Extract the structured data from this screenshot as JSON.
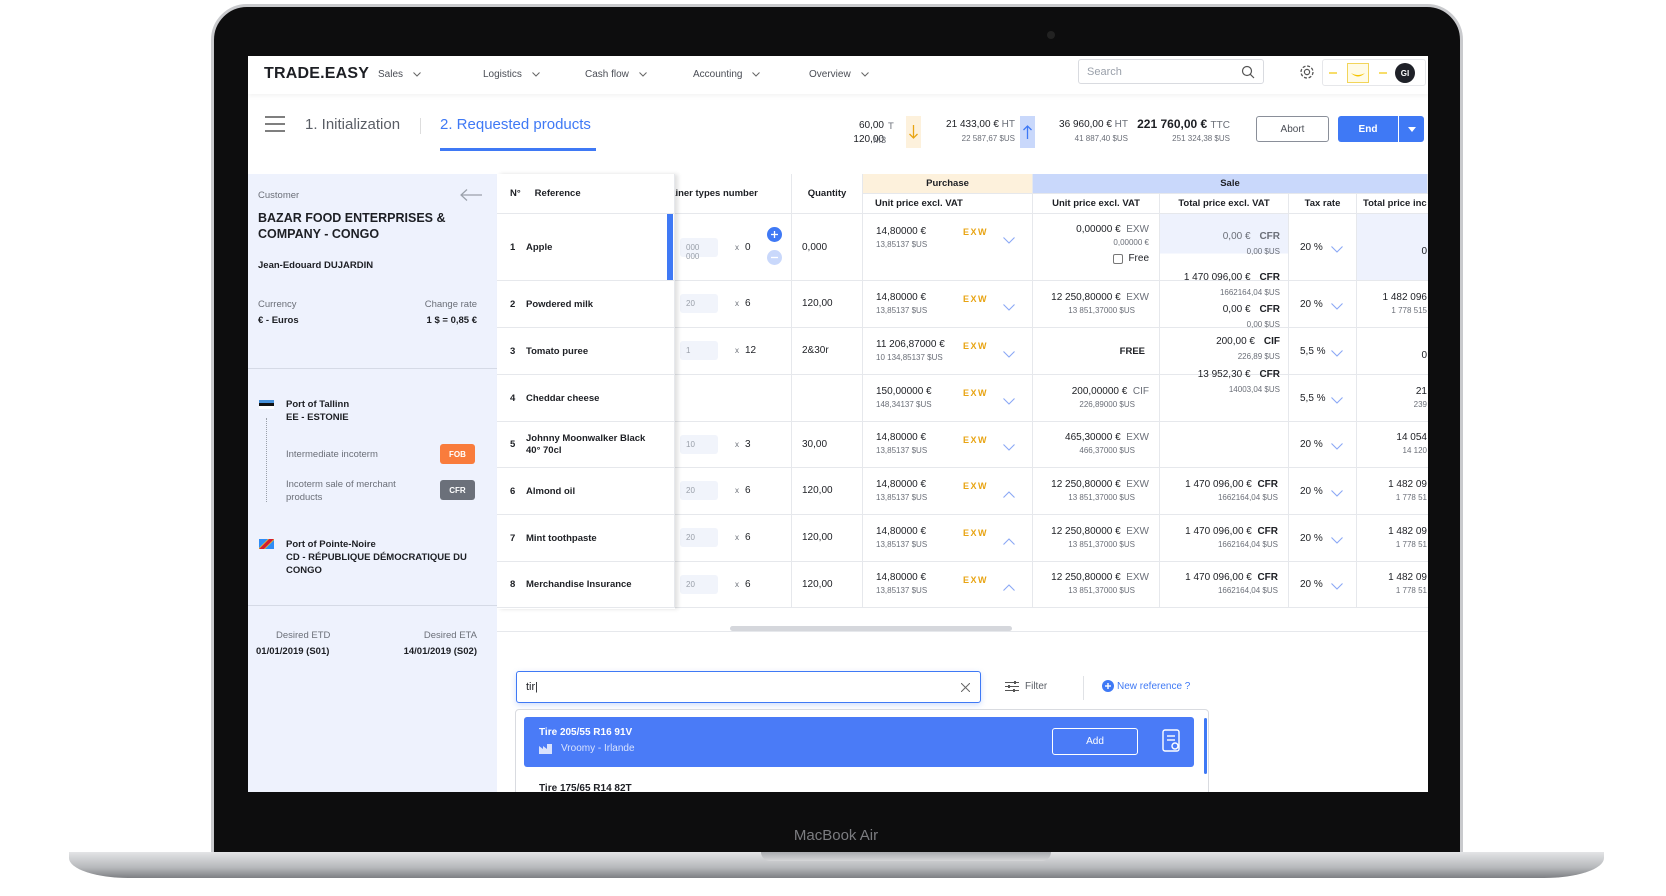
{
  "device": {
    "label": "MacBook Air"
  },
  "nav": {
    "logo": "TRADE.EASY",
    "items": [
      "Sales",
      "Logistics",
      "Cash flow",
      "Accounting",
      "Overview"
    ],
    "search_placeholder": "Search",
    "avatar": "GI"
  },
  "steps": {
    "step1": "1. Initialization",
    "step2": "2. Requested products"
  },
  "stats": {
    "weight": "60,00",
    "weight_unit": "T",
    "volume": "120,00",
    "volume_unit": "M3",
    "purchase_ht": "21 433,00 €",
    "purchase_ht_unit": "HT",
    "purchase_usd": "22 587,67 $US",
    "sale_ht": "36 960,00 €",
    "sale_ht_unit": "HT",
    "sale_usd": "41 887,40 $US",
    "total_ttc": "221 760,00 €",
    "total_ttc_unit": "TTC",
    "total_usd": "251 324,38 $US"
  },
  "actions": {
    "abort": "Abort",
    "end": "End"
  },
  "colors": {
    "accent": "#3f79f5",
    "fob": "#f97c3c",
    "cfr": "#6b707a",
    "exw": "#e8a413",
    "panel": "#eef2fd"
  },
  "customer": {
    "label": "Customer",
    "name": "BAZAR FOOD ENTERPRISES & COMPANY - CONGO",
    "contact": "Jean-Edouard DUJARDIN",
    "currency_label": "Currency",
    "currency": "€ - Euros",
    "rate_label": "Change rate",
    "rate": "1 $ =  0,85 €"
  },
  "route": {
    "origin_port": "Port of Tallinn",
    "origin_country": "EE - ESTONIE",
    "intermediate_label": "Intermediate incoterm",
    "intermediate": "FOB",
    "sale_label": "Incoterm sale of merchant products",
    "sale": "CFR",
    "dest_port": "Port of Pointe-Noire",
    "dest_country": "CD - RÉPUBLIQUE DÉMOCRATIQUE DU CONGO"
  },
  "dates": {
    "etd_label": "Desired ETD",
    "etd": "01/01/2019 (S01)",
    "eta_label": "Desired ETA",
    "eta": "14/01/2019 (S02)"
  },
  "table": {
    "headers": {
      "n": "N°",
      "ref": "Reference",
      "containers": "tainer types number",
      "qty": "Quantity",
      "purchase": "Purchase",
      "sale": "Sale",
      "p_unit": "Unit price excl. VAT",
      "s_unit": "Unit price excl. VAT",
      "s_total": "Total price excl. VAT",
      "tax": "Tax rate",
      "s_total_incl": "Total price inc"
    },
    "rows": [
      {
        "n": "1",
        "ref": "Apple",
        "pkg": "000 000",
        "mult": "0",
        "qty": "0,000",
        "p_eur": "14,80000 €",
        "p_usd": "13,85137 $US",
        "p_inc": "EXW",
        "p_open": false,
        "s_eur": "0,00000 €",
        "s_usd": "0,00000 €",
        "s_inc": "EXW",
        "free": "Free",
        "tax": "20 %",
        "ti_main": "0",
        "ti_sub": ""
      },
      {
        "n": "2",
        "ref": "Powdered milk",
        "pkg": "20",
        "mult": "6",
        "qty": "120,00",
        "p_eur": "14,80000 €",
        "p_usd": "13,85137 $US",
        "p_inc": "EXW",
        "p_open": false,
        "s_eur": "12 250,80000 €",
        "s_usd": "13 851,37000 $US",
        "s_inc": "EXW",
        "tax": "20 %",
        "ti_main": "1 482 096",
        "ti_sub": "1 778 515"
      },
      {
        "n": "3",
        "ref": "Tomato puree",
        "pkg": "1",
        "mult": "12",
        "qty": "2&30r",
        "p_eur": "11 206,87000 €",
        "p_usd": "10 134,85137 $US",
        "p_inc": "EXW",
        "p_open": false,
        "s_free": "FREE",
        "tax": "5,5 %",
        "ti_main": "0",
        "ti_sub": ""
      },
      {
        "n": "4",
        "ref": "Cheddar cheese",
        "pkg": "",
        "mult": "",
        "qty": "",
        "p_eur": "150,00000 €",
        "p_usd": "148,34137 $US",
        "p_inc": "EXW",
        "p_open": false,
        "s_eur": "200,00000 €",
        "s_usd": "226,89000 $US",
        "s_inc": "CIF",
        "tax": "5,5 %",
        "ti_main": "21",
        "ti_sub": "239"
      },
      {
        "n": "5",
        "ref": "Johnny Moonwalker Black 40° 70cl",
        "pkg": "10",
        "mult": "3",
        "qty": "30,00",
        "p_eur": "14,80000 €",
        "p_usd": "13,85137 $US",
        "p_inc": "EXW",
        "p_open": false,
        "s_eur": "465,30000 €",
        "s_usd": "466,37000 $US",
        "s_inc": "EXW",
        "tax": "20 %",
        "ti_main": "14 054",
        "ti_sub": "14 120"
      },
      {
        "n": "6",
        "ref": "Almond oil",
        "pkg": "20",
        "mult": "6",
        "qty": "120,00",
        "p_eur": "14,80000 €",
        "p_usd": "13,85137 $US",
        "p_inc": "EXW",
        "p_open": true,
        "s_eur": "12 250,80000 €",
        "s_usd": "13 851,37000 $US",
        "s_inc": "EXW",
        "t_eur": "1 470 096,00 €",
        "t_usd": "1662164,04 $US",
        "t_inc": "CFR",
        "tax": "20 %",
        "ti_main": "1 482 09",
        "ti_sub": "1 778 51"
      },
      {
        "n": "7",
        "ref": "Mint toothpaste",
        "pkg": "20",
        "mult": "6",
        "qty": "120,00",
        "p_eur": "14,80000 €",
        "p_usd": "13,85137 $US",
        "p_inc": "EXW",
        "p_open": true,
        "s_eur": "12 250,80000 €",
        "s_usd": "13 851,37000 $US",
        "s_inc": "EXW",
        "t_eur": "1 470 096,00 €",
        "t_usd": "1662164,04 $US",
        "t_inc": "CFR",
        "tax": "20 %",
        "ti_main": "1 482 09",
        "ti_sub": "1 778 51"
      },
      {
        "n": "8",
        "ref": "Merchandise Insurance",
        "pkg": "20",
        "mult": "6",
        "qty": "120,00",
        "p_eur": "14,80000 €",
        "p_usd": "13,85137 $US",
        "p_inc": "EXW",
        "p_open": true,
        "s_eur": "12 250,80000 €",
        "s_usd": "13 851,37000 $US",
        "s_inc": "EXW",
        "t_eur": "1 470 096,00 €",
        "t_usd": "1662164,04 $US",
        "t_inc": "CFR",
        "tax": "20 %",
        "ti_main": "1 482 09",
        "ti_sub": "1 778 51"
      }
    ],
    "total_stack": [
      {
        "eur": "0,00 €",
        "inc": "CFR",
        "usd": "0,00 $US",
        "muted": true
      },
      {
        "eur": "1 470 096,00 €",
        "inc": "CFR",
        "usd": "1662164,04 $US"
      },
      {
        "eur": "0,00 €",
        "inc": "CFR",
        "usd": "0,00 $US"
      },
      {
        "eur": "200,00 €",
        "inc": "CIF",
        "usd": "226,89 $US"
      },
      {
        "eur": "13 952,30 €",
        "inc": "CFR",
        "usd": "14003,04 $US"
      }
    ]
  },
  "product_search": {
    "value": "tir|",
    "filter": "Filter",
    "new_reference": "New reference ?",
    "results": [
      {
        "name": "Tire 205/55 R16 91V",
        "supplier": "Vroomy - Irlande",
        "add": "Add"
      },
      {
        "name": "Tire 175/65 R14 82T"
      }
    ]
  }
}
